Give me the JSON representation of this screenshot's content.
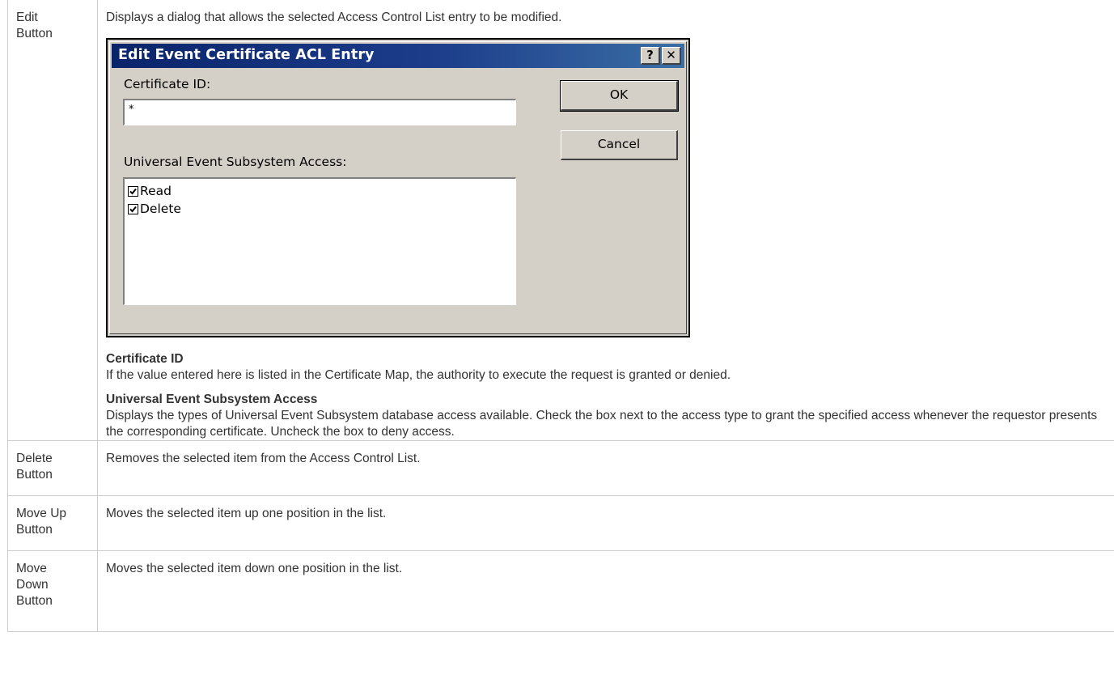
{
  "rows": [
    {
      "term": "Edit Button",
      "description": "Displays a dialog that allows the selected Access Control List entry to be modified.",
      "details": [
        {
          "heading": "Certificate ID",
          "text": "If the value entered here is listed in the Certificate Map, the authority to execute the request is granted or denied."
        },
        {
          "heading": "Universal Event Subsystem Access",
          "text": "Displays the types of Universal Event Subsystem database access available. Check the box next to the access type to grant the specified access whenever the requestor presents the corresponding certificate. Uncheck the box to deny access."
        }
      ]
    },
    {
      "term": "Delete Button",
      "description": "Removes the selected item from the Access Control List."
    },
    {
      "term": "Move Up Button",
      "description": "Moves the selected item up one position in the list."
    },
    {
      "term": "Move Down Button",
      "description": "Moves the selected item down one position in the list."
    }
  ],
  "dialog": {
    "title": "Edit Event Certificate ACL Entry",
    "help_glyph": "?",
    "close_glyph": "✕",
    "certificate_label": "Certificate ID:",
    "certificate_value": "*",
    "access_label": "Universal Event Subsystem Access:",
    "access_items": [
      {
        "label": "Read",
        "checked": true
      },
      {
        "label": "Delete",
        "checked": true
      }
    ],
    "ok_label": "OK",
    "cancel_label": "Cancel"
  }
}
